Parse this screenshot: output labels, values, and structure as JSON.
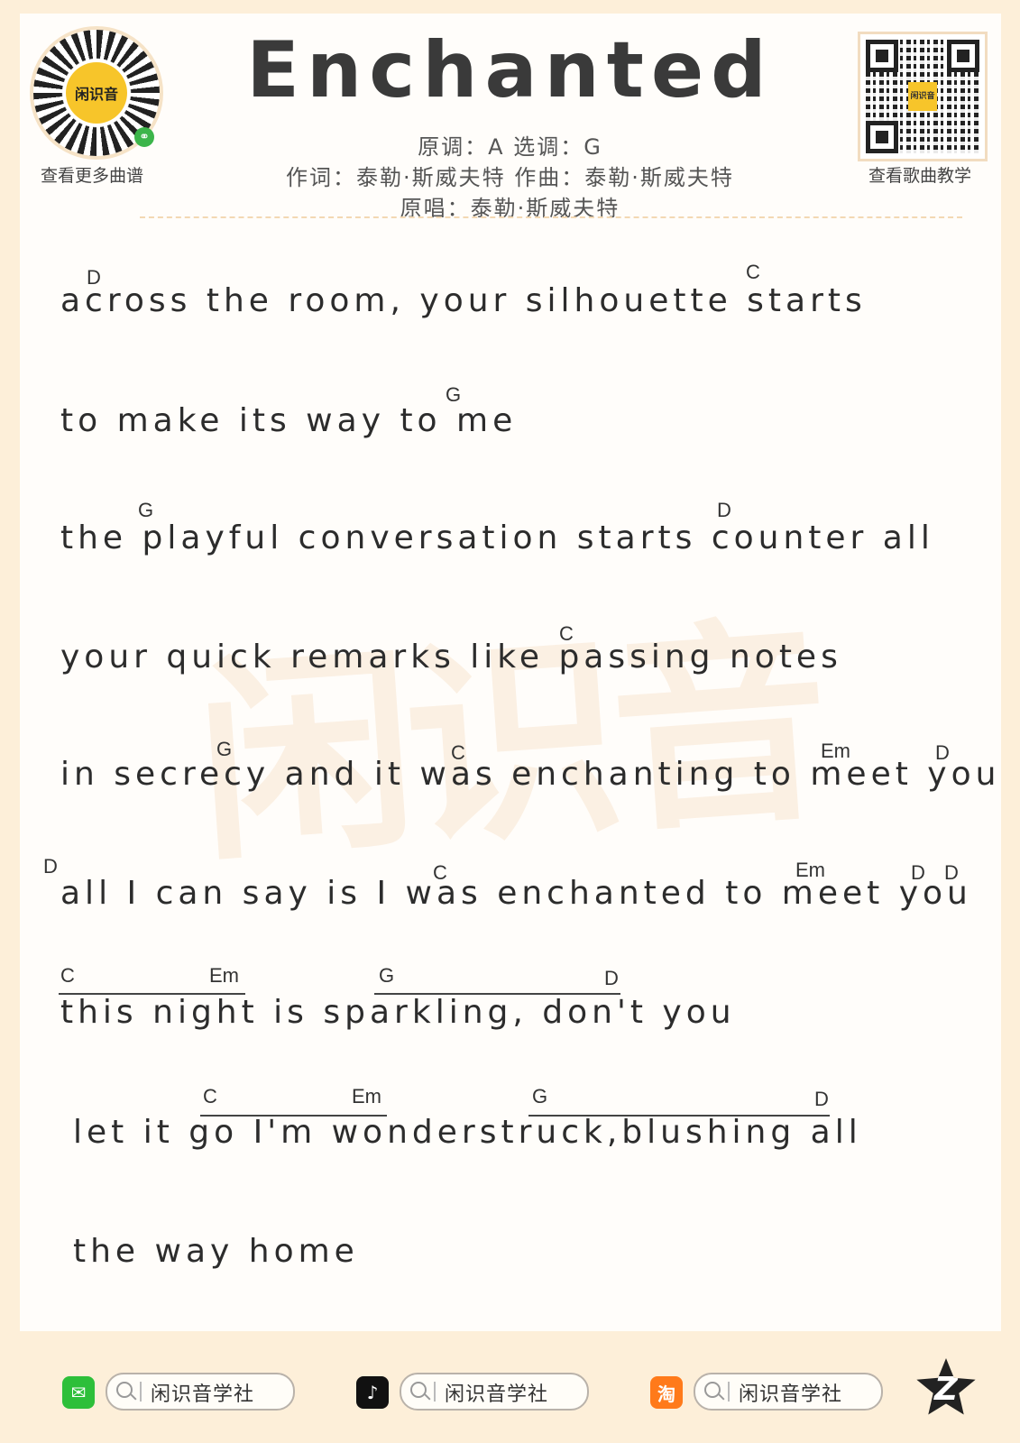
{
  "header": {
    "title": "Enchanted",
    "key_line": "原调：A   选调：G",
    "credits_line": "作词：泰勒·斯威夫特    作曲：泰勒·斯威夫特",
    "singer_line": "原唱：泰勒·斯威夫特",
    "left_label": "查看更多曲谱",
    "right_label": "查看歌曲教学",
    "mini_code_text": "闲识音",
    "qr_center_text": "闲识音"
  },
  "watermark": "闲识音",
  "lines": [
    {
      "text": "across the room,  your silhouette starts",
      "chords": [
        "D",
        "C"
      ]
    },
    {
      "text": "to make its way to me",
      "chords": [
        "G"
      ]
    },
    {
      "text": "the playful conversation starts counter all",
      "chords": [
        "G",
        "D"
      ]
    },
    {
      "text": "your quick remarks like passing notes",
      "chords": [
        "C"
      ]
    },
    {
      "text": "in secrecy and it was enchanting to meet you",
      "chords": [
        "G",
        "C",
        "Em",
        "D"
      ]
    },
    {
      "text": "all I can say is I was enchanted to meet you",
      "chords": [
        "D",
        "C",
        "Em",
        "D",
        "D"
      ]
    },
    {
      "text": "this night is sparkling, don't you",
      "chords": [
        "C",
        "Em",
        "G",
        "D"
      ]
    },
    {
      "text": "let it go I'm wonderstruck,blushing all",
      "chords": [
        "C",
        "Em",
        "G",
        "D"
      ]
    },
    {
      "text": "the way home",
      "chords": []
    }
  ],
  "footer": {
    "wechat": {
      "icon": "wechat-icon",
      "search_text": "闲识音学社"
    },
    "douyin": {
      "icon": "douyin-icon",
      "search_text": "闲识音学社"
    },
    "taobao": {
      "icon": "taobao-icon",
      "icon_text": "淘",
      "search_text": "闲识音学社"
    },
    "logo_text": "Z"
  },
  "colors": {
    "background": "#fdefd9",
    "sheet": "#fffdfa",
    "accent": "#f7c52a"
  }
}
